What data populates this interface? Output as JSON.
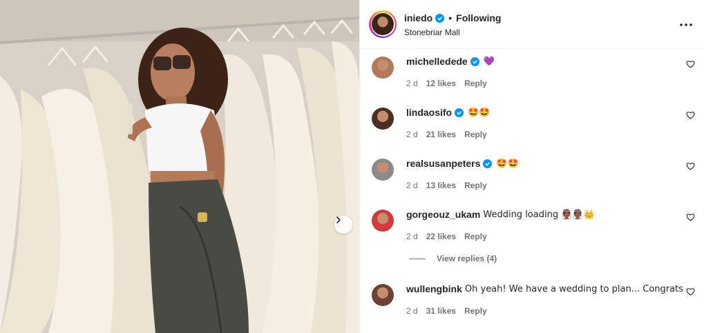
{
  "post": {
    "username": "iniedo",
    "follow_status": "Following",
    "separator": "•",
    "location": "Stonebriar Mall"
  },
  "comments": [
    {
      "user": "michelledede",
      "verified": true,
      "text": "💜",
      "age": "2 d",
      "likes": "12 likes",
      "reply": "Reply",
      "avatar_color": "#b07a5b"
    },
    {
      "user": "lindaosifo",
      "verified": true,
      "text": "🤩🤩",
      "age": "2 d",
      "likes": "21 likes",
      "reply": "Reply",
      "avatar_color": "#4b2f22"
    },
    {
      "user": "realsusanpeters",
      "verified": true,
      "text": "🤩🤩",
      "age": "2 d",
      "likes": "13 likes",
      "reply": "Reply",
      "avatar_color": "#8a8a8a"
    },
    {
      "user": "gorgeouz_ukam",
      "verified": false,
      "text": "Wedding loading 👰🏾👰🏾👑",
      "age": "2 d",
      "likes": "22 likes",
      "reply": "Reply",
      "avatar_color": "#d23b3b"
    },
    {
      "user": "wullengbink",
      "verified": false,
      "text": "Oh yeah! We have a wedding to plan... Congrats",
      "age": "2 d",
      "likes": "31 likes",
      "reply": "Reply",
      "avatar_color": "#6b4233"
    }
  ],
  "view_replies": "View replies (4)",
  "colors": {
    "verified": "#0095f6",
    "muted": "#737373",
    "text": "#262626",
    "border": "#efefef"
  },
  "icons": {
    "more": "more-options-icon",
    "heart": "heart-outline-icon",
    "next": "chevron-right-icon",
    "verified": "verified-badge-icon"
  }
}
